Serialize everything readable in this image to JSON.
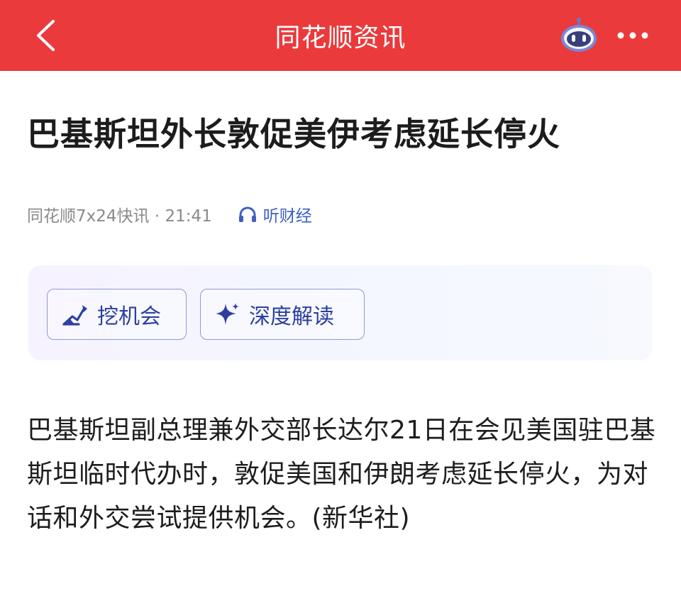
{
  "header": {
    "title": "同花顺资讯",
    "back_icon": "chevron-left-icon",
    "assistant_icon": "robot-icon",
    "more_icon": "more-dots-icon",
    "background_color": "#ea3a3c"
  },
  "article": {
    "title": "巴基斯坦外长敦促美伊考虑延长停火",
    "meta": {
      "source_time": "同花顺7x24快讯 · 21:41",
      "listen_label": "听财经",
      "listen_icon": "headphones-icon"
    },
    "actions": [
      {
        "label": "挖机会",
        "icon": "excavator-icon"
      },
      {
        "label": "深度解读",
        "icon": "sparkle-icon"
      }
    ],
    "body": "巴基斯坦副总理兼外交部长达尔21日在会见美国驻巴基斯坦临时代办时，敦促美国和伊朗考虑延长停火，为对话和外交尝试提供机会。(新华社)"
  }
}
